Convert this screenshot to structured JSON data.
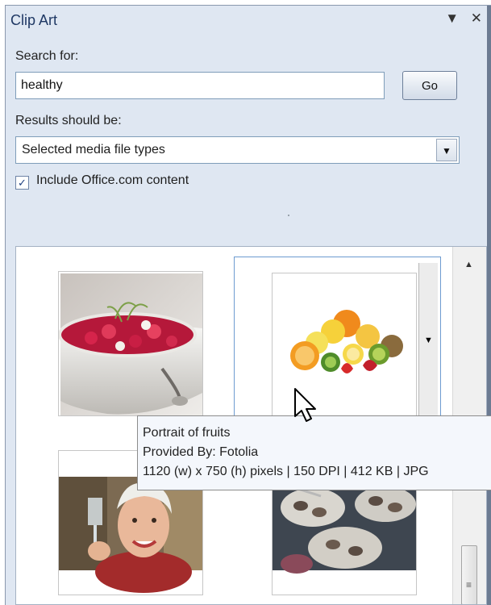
{
  "pane": {
    "title": "Clip Art",
    "menu_icon": "▼",
    "close_icon": "✕"
  },
  "search": {
    "label": "Search for:",
    "value": "healthy",
    "go_label": "Go"
  },
  "results_filter": {
    "label": "Results should be:",
    "selected": "Selected media file types"
  },
  "include_office": {
    "label": "Include Office.com content",
    "checked": true
  },
  "clips": [
    {
      "name": "soup-bowl-clip",
      "subject": "beet soup in white bowl"
    },
    {
      "name": "fruits-clip",
      "subject": "Portrait of fruits"
    },
    {
      "name": "woman-toasting-clip",
      "subject": "smiling senior woman with glass"
    },
    {
      "name": "oysters-clip",
      "subject": "plates of oysters"
    }
  ],
  "tooltip": {
    "title": "Portrait of fruits",
    "provider": "Provided By: Fotolia",
    "details": "1120 (w) x 750 (h) pixels | 150 DPI | 412 KB | JPG"
  },
  "colors": {
    "pane_bg": "#dfe7f2",
    "title_color": "#1f3864",
    "selection_border": "#6d9bd0"
  }
}
